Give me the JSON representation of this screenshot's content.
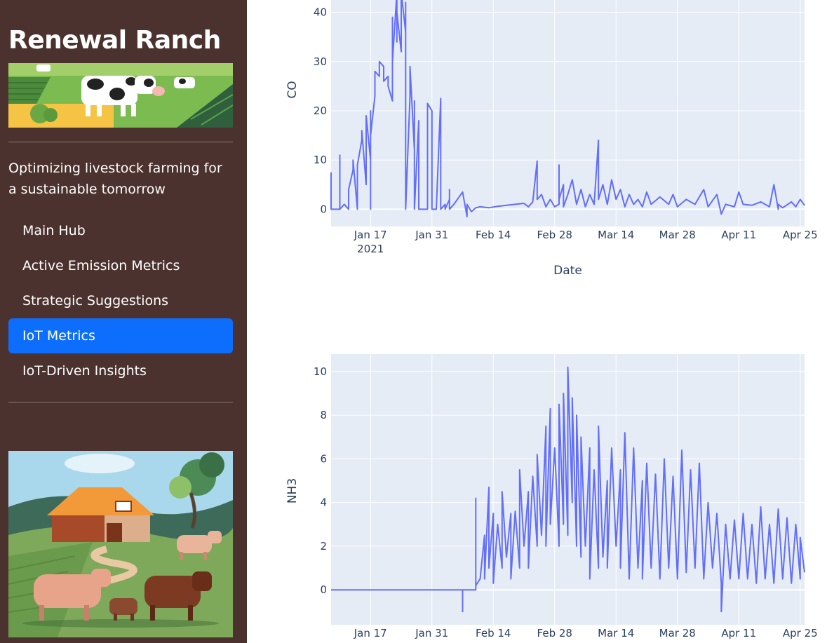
{
  "sidebar": {
    "title": "Renewal Ranch",
    "tagline": "Optimizing livestock farming for a sustainable tomorrow",
    "nav": [
      {
        "label": "Main Hub",
        "active": false
      },
      {
        "label": "Active Emission Metrics",
        "active": false
      },
      {
        "label": "Strategic Suggestions",
        "active": false
      },
      {
        "label": "IoT Metrics",
        "active": true
      },
      {
        "label": "IoT-Driven Insights",
        "active": false
      }
    ],
    "images": {
      "banner": "farm-cows-banner",
      "illustration": "barn-cattle-illustration"
    }
  },
  "colors": {
    "sidebar_bg": "#4b322e",
    "active_nav": "#0d6efd",
    "plot_bg": "#e5ecf6",
    "grid": "#ffffff",
    "line": "#636efa",
    "axis_text": "#2a3f5f"
  },
  "chart_data": [
    {
      "type": "line",
      "xlabel": "Date",
      "ylabel": "CO",
      "x_ticks": [
        "Jan 17\n2021",
        "Jan 31",
        "Feb 14",
        "Feb 28",
        "Mar 14",
        "Mar 28",
        "Apr 11",
        "Apr 25"
      ],
      "y_ticks": [
        0,
        10,
        20,
        30,
        40
      ],
      "xlim": [
        "2021-01-08",
        "2021-04-26"
      ],
      "ylim": [
        -3.5,
        42.5
      ],
      "grid": true,
      "series": [
        {
          "color": "#636efa",
          "points": [
            [
              "2021-01-08",
              7.5
            ],
            [
              "2021-01-08",
              0
            ],
            [
              "2021-01-09",
              0
            ],
            [
              "2021-01-10",
              0
            ],
            [
              "2021-01-10",
              11
            ],
            [
              "2021-01-10",
              0
            ],
            [
              "2021-01-11",
              1
            ],
            [
              "2021-01-12",
              0
            ],
            [
              "2021-01-12",
              4
            ],
            [
              "2021-01-13",
              8
            ],
            [
              "2021-01-13",
              10
            ],
            [
              "2021-01-14",
              0
            ],
            [
              "2021-01-14",
              9
            ],
            [
              "2021-01-15",
              14
            ],
            [
              "2021-01-15",
              16
            ],
            [
              "2021-01-16",
              5
            ],
            [
              "2021-01-16",
              19
            ],
            [
              "2021-01-17",
              10
            ],
            [
              "2021-01-17",
              20
            ],
            [
              "2021-01-17",
              0
            ],
            [
              "2021-01-17",
              15
            ],
            [
              "2021-01-18",
              23
            ],
            [
              "2021-01-18",
              28
            ],
            [
              "2021-01-19",
              27
            ],
            [
              "2021-01-19",
              30
            ],
            [
              "2021-01-20",
              29
            ],
            [
              "2021-01-20",
              26
            ],
            [
              "2021-01-21",
              27
            ],
            [
              "2021-01-21",
              25
            ],
            [
              "2021-01-22",
              22
            ],
            [
              "2021-01-22",
              39
            ],
            [
              "2021-01-22",
              30
            ],
            [
              "2021-01-23",
              44
            ],
            [
              "2021-01-23",
              34
            ],
            [
              "2021-01-23",
              40
            ],
            [
              "2021-01-24",
              32
            ],
            [
              "2021-01-24",
              44
            ],
            [
              "2021-01-25",
              36
            ],
            [
              "2021-01-25",
              42
            ],
            [
              "2021-01-25",
              30
            ],
            [
              "2021-01-25",
              0
            ],
            [
              "2021-01-26",
              23
            ],
            [
              "2021-01-26",
              29
            ],
            [
              "2021-01-27",
              12
            ],
            [
              "2021-01-27",
              22
            ],
            [
              "2021-01-27",
              0
            ],
            [
              "2021-01-28",
              18
            ],
            [
              "2021-01-28",
              0
            ],
            [
              "2021-01-29",
              0
            ],
            [
              "2021-01-30",
              0
            ],
            [
              "2021-01-30",
              10
            ],
            [
              "2021-01-30",
              21.5
            ],
            [
              "2021-01-31",
              20
            ],
            [
              "2021-01-31",
              0
            ],
            [
              "2021-02-01",
              0
            ],
            [
              "2021-02-02",
              22.5
            ],
            [
              "2021-02-02",
              0
            ],
            [
              "2021-02-03",
              1
            ],
            [
              "2021-02-03",
              0
            ],
            [
              "2021-02-04",
              2
            ],
            [
              "2021-02-04",
              4
            ],
            [
              "2021-02-04",
              0
            ],
            [
              "2021-02-05",
              1
            ],
            [
              "2021-02-07",
              3.5
            ],
            [
              "2021-02-08",
              -1.5
            ],
            [
              "2021-02-08",
              1
            ],
            [
              "2021-02-09",
              -0.5
            ],
            [
              "2021-02-10",
              0.3
            ],
            [
              "2021-02-11",
              0.5
            ],
            [
              "2021-02-13",
              0.3
            ],
            [
              "2021-02-15",
              0.6
            ],
            [
              "2021-02-17",
              0.8
            ],
            [
              "2021-02-19",
              1
            ],
            [
              "2021-02-21",
              1.2
            ],
            [
              "2021-02-22",
              0.5
            ],
            [
              "2021-02-23",
              1.5
            ],
            [
              "2021-02-24",
              9.8
            ],
            [
              "2021-02-24",
              2
            ],
            [
              "2021-02-25",
              3
            ],
            [
              "2021-02-26",
              0.5
            ],
            [
              "2021-02-27",
              2
            ],
            [
              "2021-02-28",
              0.5
            ],
            [
              "2021-03-01",
              1
            ],
            [
              "2021-03-01",
              9
            ],
            [
              "2021-03-01",
              2
            ],
            [
              "2021-03-02",
              5
            ],
            [
              "2021-03-02",
              0.5
            ],
            [
              "2021-03-03",
              3
            ],
            [
              "2021-03-04",
              6
            ],
            [
              "2021-03-05",
              1
            ],
            [
              "2021-03-06",
              4
            ],
            [
              "2021-03-07",
              0.5
            ],
            [
              "2021-03-08",
              3
            ],
            [
              "2021-03-09",
              1
            ],
            [
              "2021-03-10",
              14
            ],
            [
              "2021-03-10",
              2
            ],
            [
              "2021-03-11",
              5
            ],
            [
              "2021-03-12",
              1
            ],
            [
              "2021-03-13",
              6
            ],
            [
              "2021-03-14",
              2
            ],
            [
              "2021-03-15",
              4
            ],
            [
              "2021-03-16",
              0.5
            ],
            [
              "2021-03-17",
              3
            ],
            [
              "2021-03-18",
              1
            ],
            [
              "2021-03-19",
              2
            ],
            [
              "2021-03-20",
              0.5
            ],
            [
              "2021-03-21",
              3.5
            ],
            [
              "2021-03-22",
              1
            ],
            [
              "2021-03-24",
              2.5
            ],
            [
              "2021-03-26",
              1
            ],
            [
              "2021-03-27",
              3
            ],
            [
              "2021-03-28",
              0.5
            ],
            [
              "2021-03-30",
              2
            ],
            [
              "2021-04-01",
              1
            ],
            [
              "2021-04-03",
              4
            ],
            [
              "2021-04-04",
              0.5
            ],
            [
              "2021-04-06",
              3
            ],
            [
              "2021-04-07",
              -1
            ],
            [
              "2021-04-08",
              1
            ],
            [
              "2021-04-10",
              0.5
            ],
            [
              "2021-04-11",
              3.5
            ],
            [
              "2021-04-12",
              1
            ],
            [
              "2021-04-14",
              0.8
            ],
            [
              "2021-04-16",
              1.5
            ],
            [
              "2021-04-18",
              0.5
            ],
            [
              "2021-04-19",
              5
            ],
            [
              "2021-04-20",
              0
            ],
            [
              "2021-04-20",
              1
            ],
            [
              "2021-04-21",
              0.3
            ],
            [
              "2021-04-23",
              1.5
            ],
            [
              "2021-04-24",
              0.5
            ],
            [
              "2021-04-25",
              2
            ],
            [
              "2021-04-26",
              0.8
            ]
          ]
        }
      ]
    },
    {
      "type": "line",
      "xlabel": "",
      "ylabel": "NH3",
      "x_ticks": [
        "Jan 17",
        "Jan 31",
        "Feb 14",
        "Feb 28",
        "Mar 14",
        "Mar 28",
        "Apr 11",
        "Apr 25"
      ],
      "y_ticks": [
        0,
        2,
        4,
        6,
        8,
        10
      ],
      "xlim": [
        "2021-01-08",
        "2021-04-26"
      ],
      "ylim": [
        -1.6,
        10.8
      ],
      "grid": true,
      "series": [
        {
          "color": "#636efa",
          "points": [
            [
              "2021-01-08",
              0
            ],
            [
              "2021-01-20",
              0
            ],
            [
              "2021-02-01",
              0
            ],
            [
              "2021-02-07",
              0
            ],
            [
              "2021-02-07",
              -1
            ],
            [
              "2021-02-07",
              0
            ],
            [
              "2021-02-10",
              0
            ],
            [
              "2021-02-10",
              4.2
            ],
            [
              "2021-02-10",
              0.2
            ],
            [
              "2021-02-11",
              0.5
            ],
            [
              "2021-02-12",
              2.5
            ],
            [
              "2021-02-12",
              0.5
            ],
            [
              "2021-02-13",
              4.7
            ],
            [
              "2021-02-13",
              1
            ],
            [
              "2021-02-14",
              3.5
            ],
            [
              "2021-02-14",
              0.3
            ],
            [
              "2021-02-15",
              3
            ],
            [
              "2021-02-16",
              1
            ],
            [
              "2021-02-16",
              4.5
            ],
            [
              "2021-02-17",
              1.5
            ],
            [
              "2021-02-18",
              3.5
            ],
            [
              "2021-02-18",
              0.5
            ],
            [
              "2021-02-19",
              3.6
            ],
            [
              "2021-02-20",
              1
            ],
            [
              "2021-02-20",
              5.5
            ],
            [
              "2021-02-21",
              2
            ],
            [
              "2021-02-22",
              4.5
            ],
            [
              "2021-02-22",
              1
            ],
            [
              "2021-02-23",
              5.2
            ],
            [
              "2021-02-24",
              2
            ],
            [
              "2021-02-24",
              6.2
            ],
            [
              "2021-02-25",
              2.5
            ],
            [
              "2021-02-26",
              7.5
            ],
            [
              "2021-02-26",
              2
            ],
            [
              "2021-02-27",
              8.3
            ],
            [
              "2021-02-27",
              3
            ],
            [
              "2021-02-28",
              6.5
            ],
            [
              "2021-03-01",
              2
            ],
            [
              "2021-03-01",
              8.5
            ],
            [
              "2021-03-02",
              3
            ],
            [
              "2021-03-02",
              9
            ],
            [
              "2021-03-03",
              2.5
            ],
            [
              "2021-03-03",
              10.2
            ],
            [
              "2021-03-04",
              4
            ],
            [
              "2021-03-04",
              8.8
            ],
            [
              "2021-03-05",
              2
            ],
            [
              "2021-03-05",
              8
            ],
            [
              "2021-03-06",
              1.5
            ],
            [
              "2021-03-06",
              7
            ],
            [
              "2021-03-07",
              2
            ],
            [
              "2021-03-08",
              6.5
            ],
            [
              "2021-03-08",
              0.5
            ],
            [
              "2021-03-09",
              5.5
            ],
            [
              "2021-03-10",
              1
            ],
            [
              "2021-03-10",
              7.5
            ],
            [
              "2021-03-11",
              1.5
            ],
            [
              "2021-03-12",
              5
            ],
            [
              "2021-03-12",
              1
            ],
            [
              "2021-03-13",
              6.5
            ],
            [
              "2021-03-14",
              2
            ],
            [
              "2021-03-15",
              5.5
            ],
            [
              "2021-03-15",
              1
            ],
            [
              "2021-03-16",
              7.2
            ],
            [
              "2021-03-17",
              0.5
            ],
            [
              "2021-03-18",
              6.5
            ],
            [
              "2021-03-19",
              1
            ],
            [
              "2021-03-20",
              5
            ],
            [
              "2021-03-20",
              0.5
            ],
            [
              "2021-03-21",
              5.8
            ],
            [
              "2021-03-22",
              1
            ],
            [
              "2021-03-23",
              5.3
            ],
            [
              "2021-03-24",
              0.5
            ],
            [
              "2021-03-25",
              6
            ],
            [
              "2021-03-26",
              1
            ],
            [
              "2021-03-27",
              5.2
            ],
            [
              "2021-03-28",
              0.5
            ],
            [
              "2021-03-29",
              6.4
            ],
            [
              "2021-03-30",
              0.8
            ],
            [
              "2021-03-31",
              5.5
            ],
            [
              "2021-04-01",
              1
            ],
            [
              "2021-04-02",
              5.8
            ],
            [
              "2021-04-03",
              0.5
            ],
            [
              "2021-04-04",
              4
            ],
            [
              "2021-04-05",
              1
            ],
            [
              "2021-04-06",
              3.5
            ],
            [
              "2021-04-07",
              0.3
            ],
            [
              "2021-04-07",
              -1
            ],
            [
              "2021-04-08",
              3
            ],
            [
              "2021-04-09",
              0.5
            ],
            [
              "2021-04-10",
              3.2
            ],
            [
              "2021-04-11",
              0.5
            ],
            [
              "2021-04-12",
              3.5
            ],
            [
              "2021-04-13",
              0.5
            ],
            [
              "2021-04-14",
              3
            ],
            [
              "2021-04-15",
              0.3
            ],
            [
              "2021-04-16",
              3.8
            ],
            [
              "2021-04-17",
              0.5
            ],
            [
              "2021-04-18",
              3
            ],
            [
              "2021-04-19",
              0.3
            ],
            [
              "2021-04-20",
              3.7
            ],
            [
              "2021-04-21",
              0.5
            ],
            [
              "2021-04-22",
              3.3
            ],
            [
              "2021-04-23",
              0.3
            ],
            [
              "2021-04-24",
              3
            ],
            [
              "2021-04-25",
              0.5
            ],
            [
              "2021-04-25",
              2.4
            ],
            [
              "2021-04-26",
              0.8
            ]
          ]
        }
      ]
    }
  ]
}
